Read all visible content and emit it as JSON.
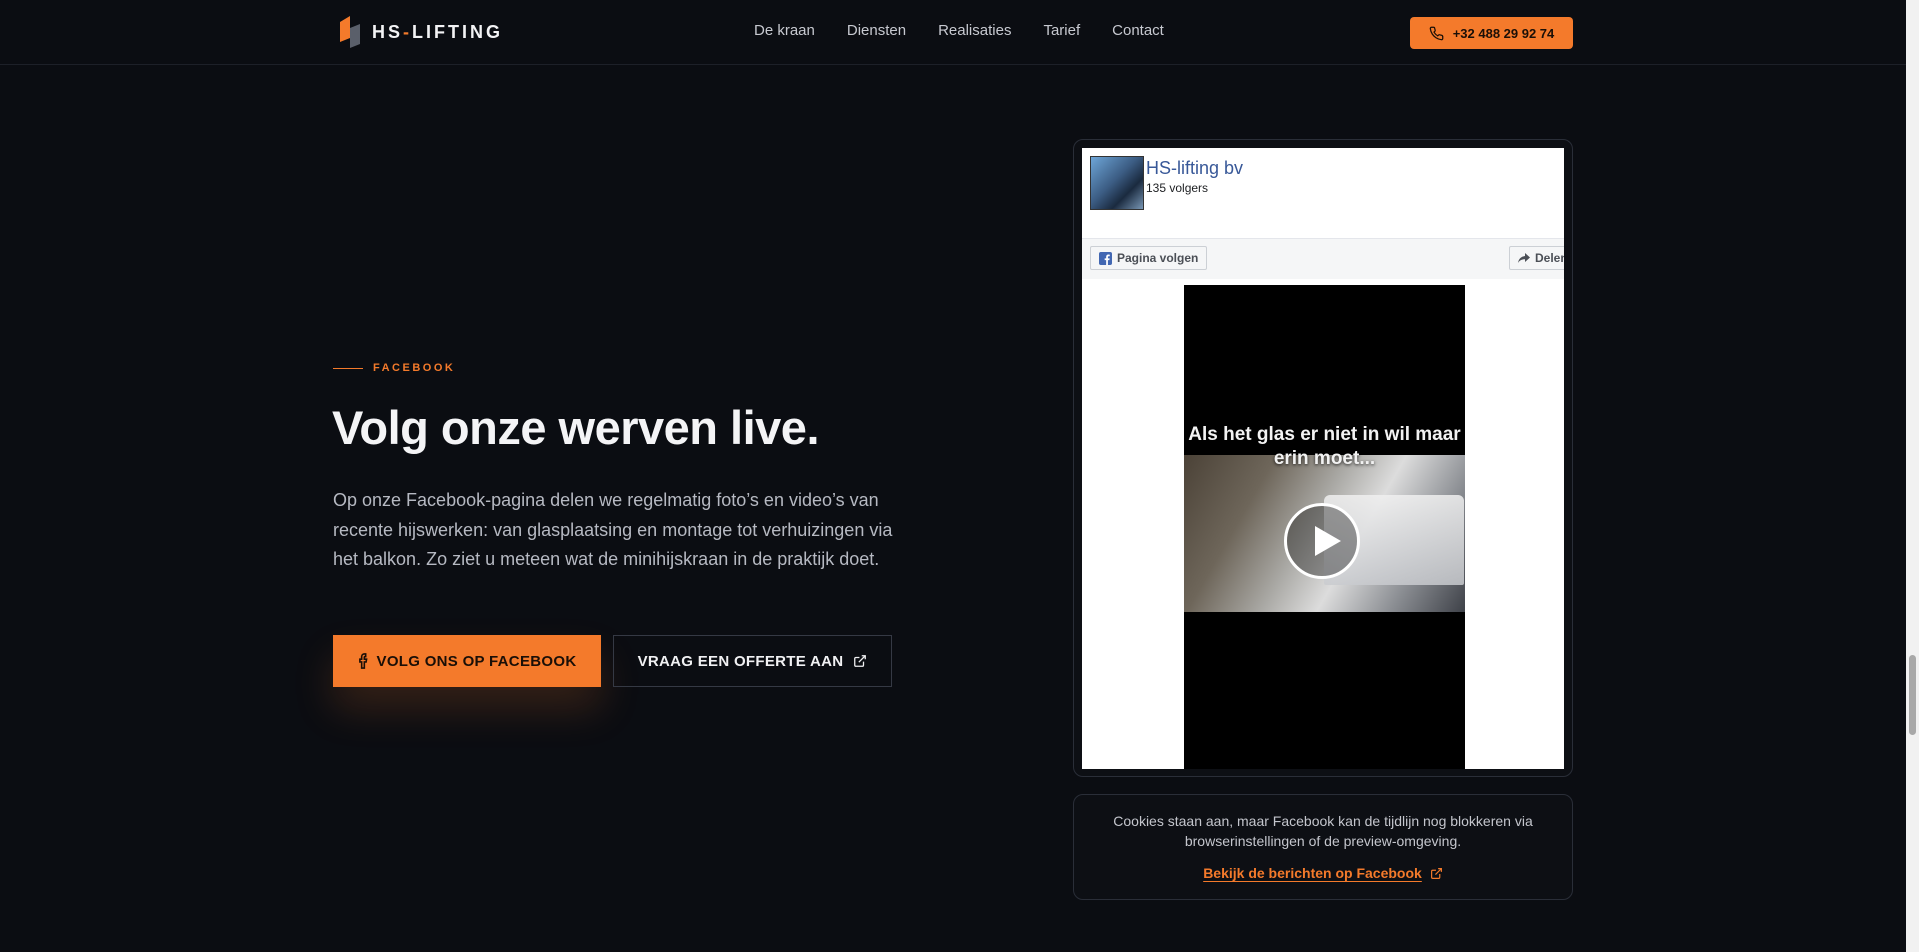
{
  "header": {
    "logo_text": "HS",
    "logo_text_2": "LIFTING",
    "nav": [
      "De kraan",
      "Diensten",
      "Realisaties",
      "Tarief",
      "Contact"
    ],
    "phone": "+32 488 29 92 74"
  },
  "section": {
    "eyebrow": "FACEBOOK",
    "heading": "Volg onze werven live.",
    "body": "Op onze Facebook-pagina delen we regelmatig foto’s en video’s van recente hijswerken: van glasplaatsing en montage tot verhuizingen via het balkon. Zo ziet u meteen wat de minihijskraan in de praktijk doet.",
    "cta_primary": "VOLG ONS OP FACEBOOK",
    "cta_secondary": "VRAAG EEN OFFERTE AAN"
  },
  "facebook_widget": {
    "page_name": "HS-lifting bv",
    "followers": "135 volgers",
    "follow_label": "Pagina volgen",
    "share_label": "Delen",
    "video_caption": "Als het glas er niet in wil maar erin moet..."
  },
  "cookie_note": {
    "text": "Cookies staan aan, maar Facebook kan de tijdlijn nog blokkeren via browserinstellingen of de preview-omgeving.",
    "link": "Bekijk de berichten op Facebook"
  },
  "colors": {
    "accent": "#f47a2b",
    "background": "#0b0d12",
    "facebook_blue": "#385898"
  }
}
